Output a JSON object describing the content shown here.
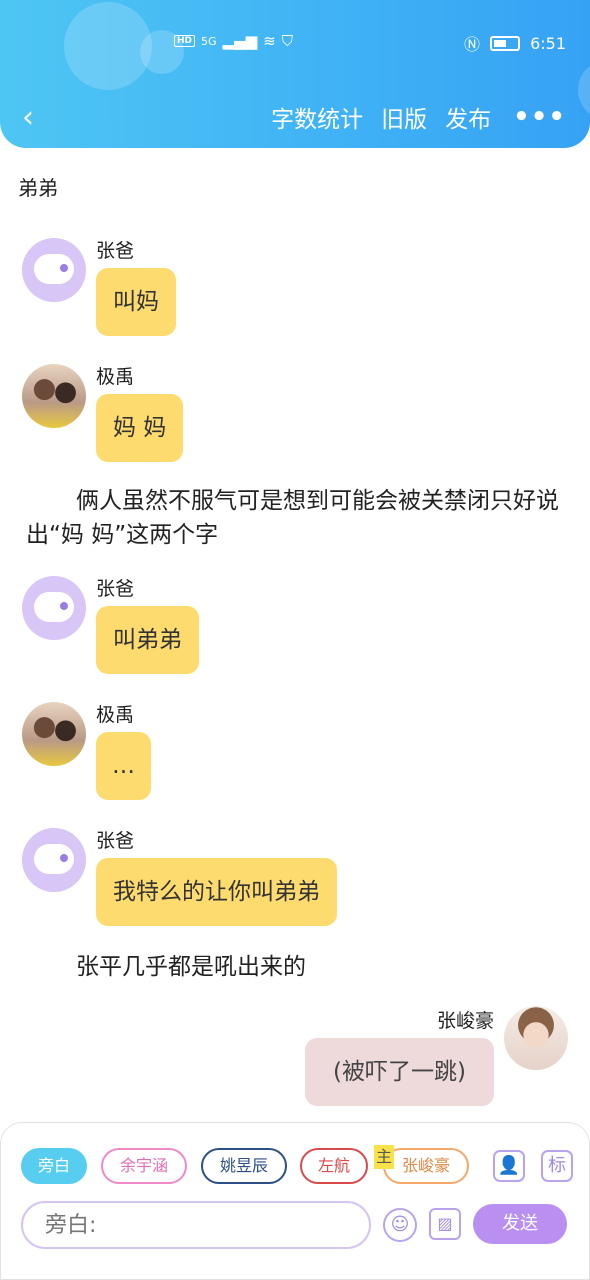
{
  "status_bar": {
    "hd": "HD",
    "network": "5G",
    "time": "6:51"
  },
  "header": {
    "back_label": "‹",
    "word_count": "字数统计",
    "old_version": "旧版",
    "publish": "发布",
    "more": "•••"
  },
  "story_title": "弟弟",
  "messages": [
    {
      "name": "张爸",
      "text": "叫妈"
    },
    {
      "name": "极禹",
      "text": "妈 妈"
    },
    {
      "name": "张爸",
      "text": "叫弟弟"
    },
    {
      "name": "极禹",
      "text": "…"
    },
    {
      "name": "张爸",
      "text": "我特么的让你叫弟弟"
    }
  ],
  "narrations": [
    "俩人虽然不服气可是想到可能会被关禁闭只好说出“妈 妈”这两个字",
    "张平几乎都是吼出来的"
  ],
  "right_message": {
    "name": "张峻豪",
    "text": "(被吓了一跳)"
  },
  "bottom": {
    "chips": [
      "旁白",
      "余宇涵",
      "姚昱辰",
      "左航",
      "张峻豪"
    ],
    "main_tag": "主",
    "tag_icon": "标",
    "input_placeholder": "旁白:",
    "send": "发送"
  },
  "colors": {
    "header": "#3fb1f5",
    "bubble": "#fedb6e",
    "right_bubble": "#eedada",
    "send": "#b98ff2",
    "active_chip": "#57cdf0"
  }
}
